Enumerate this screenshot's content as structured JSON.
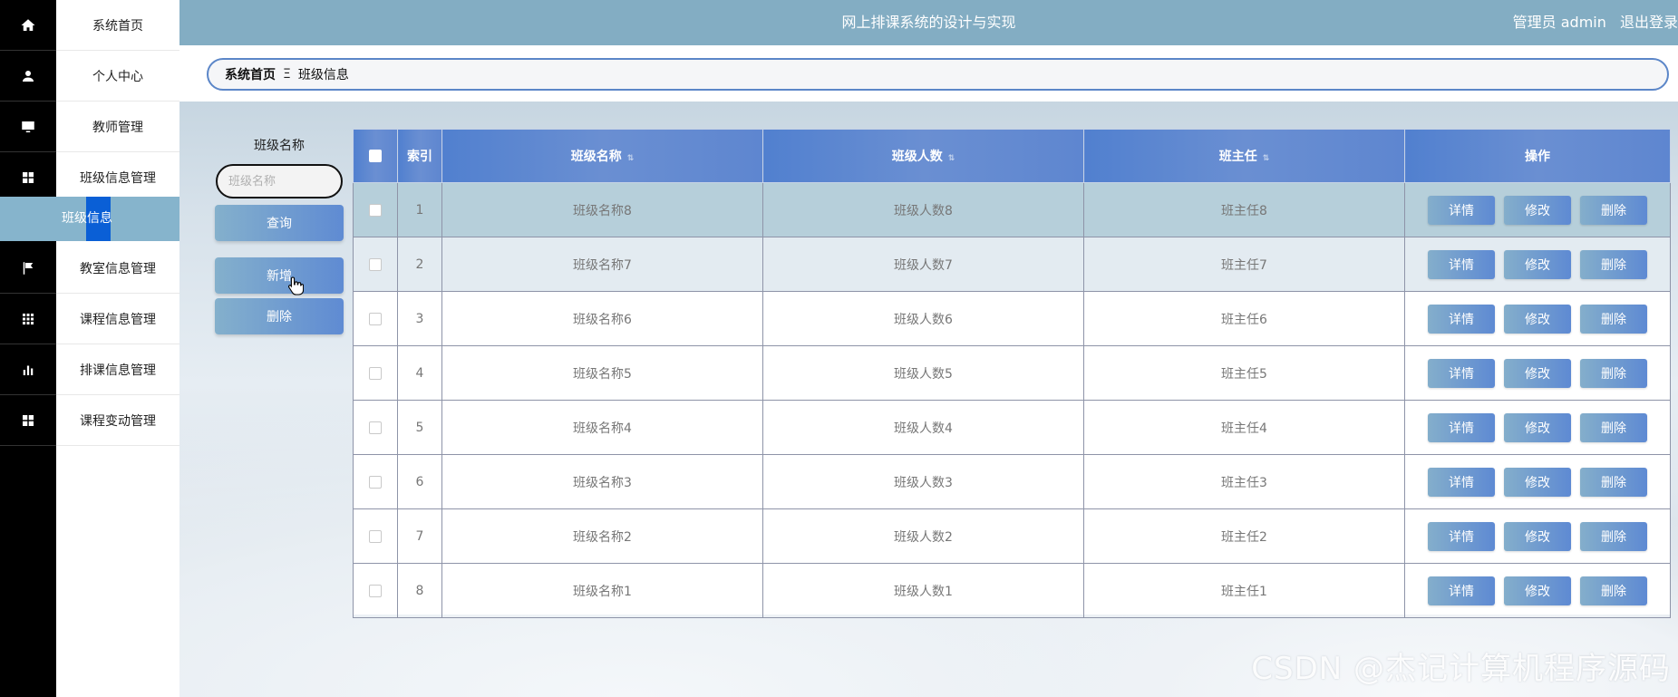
{
  "header": {
    "title": "网上排课系统的设计与实现",
    "user": "管理员 admin",
    "logout": "退出登录"
  },
  "nav": {
    "items": [
      {
        "label": "系统首页",
        "icon": "home-icon"
      },
      {
        "label": "个人中心",
        "icon": "user-icon"
      },
      {
        "label": "教师管理",
        "icon": "monitor-icon"
      },
      {
        "label": "班级信息管理",
        "icon": "grid-icon"
      },
      {
        "label": "班级信息",
        "icon": "",
        "active": true
      },
      {
        "label": "教室信息管理",
        "icon": "flag-icon"
      },
      {
        "label": "课程信息管理",
        "icon": "apps-icon"
      },
      {
        "label": "排课信息管理",
        "icon": "bar-chart-icon"
      },
      {
        "label": "课程变动管理",
        "icon": "grid-icon"
      }
    ]
  },
  "breadcrumb": {
    "home": "系统首页",
    "separator": "Ξ",
    "current": "班级信息"
  },
  "search": {
    "label": "班级名称",
    "placeholder": "班级名称",
    "query_label": "查询",
    "add_label": "新增",
    "delete_label": "删除"
  },
  "table": {
    "columns": [
      "索引",
      "班级名称",
      "班级人数",
      "班主任",
      "操作"
    ],
    "sort_icon": "⇅",
    "rows": [
      {
        "index": "1",
        "name": "班级名称8",
        "count": "班级人数8",
        "teacher": "班主任8"
      },
      {
        "index": "2",
        "name": "班级名称7",
        "count": "班级人数7",
        "teacher": "班主任7"
      },
      {
        "index": "3",
        "name": "班级名称6",
        "count": "班级人数6",
        "teacher": "班主任6"
      },
      {
        "index": "4",
        "name": "班级名称5",
        "count": "班级人数5",
        "teacher": "班主任5"
      },
      {
        "index": "5",
        "name": "班级名称4",
        "count": "班级人数4",
        "teacher": "班主任4"
      },
      {
        "index": "6",
        "name": "班级名称3",
        "count": "班级人数3",
        "teacher": "班主任3"
      },
      {
        "index": "7",
        "name": "班级名称2",
        "count": "班级人数2",
        "teacher": "班主任2"
      },
      {
        "index": "8",
        "name": "班级名称1",
        "count": "班级人数1",
        "teacher": "班主任1"
      }
    ],
    "actions": {
      "detail": "详情",
      "edit": "修改",
      "delete": "删除"
    }
  },
  "watermark": "CSDN @杰记计算机程序源码",
  "colors": {
    "header": "#83adc3",
    "active_nav": "#86b4cc",
    "table_head": "#5180cf",
    "button": "#5e8ad3"
  }
}
